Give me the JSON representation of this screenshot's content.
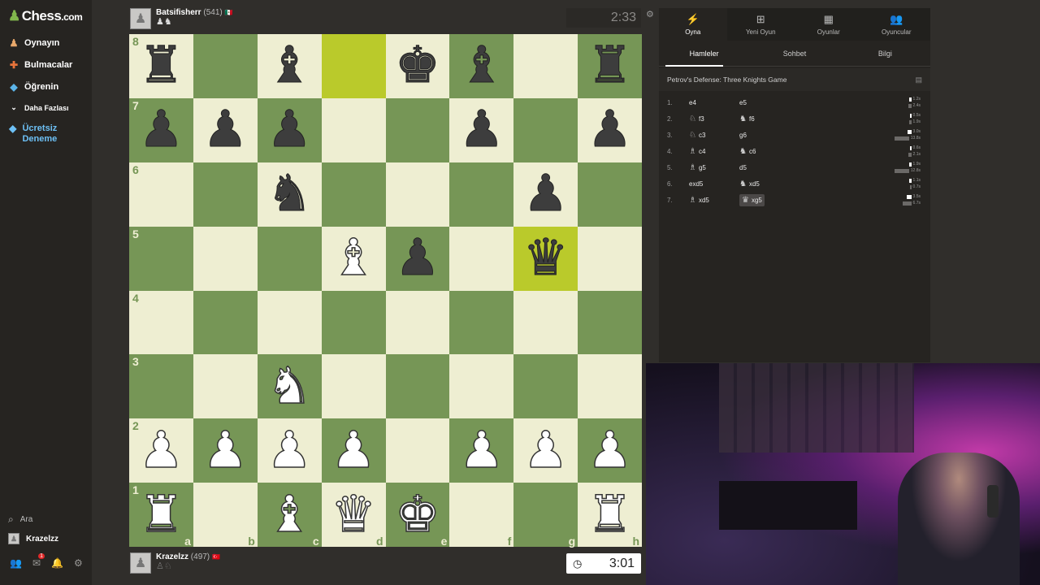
{
  "sidebar": {
    "logo_text": "Chess",
    "logo_domain": ".com",
    "logo_icon": "pawn-icon",
    "items": [
      {
        "label": "Oynayın",
        "icon": "play-icon"
      },
      {
        "label": "Bulmacalar",
        "icon": "puzzle-icon"
      },
      {
        "label": "Öğrenin",
        "icon": "learn-icon"
      },
      {
        "label": "Daha Fazlası",
        "icon": "chevron-down-icon"
      },
      {
        "label": "Ücretsiz Deneme",
        "icon": "diamond-icon"
      }
    ],
    "search_label": "Ara",
    "user_label": "Krazelzz",
    "notification_count": "1"
  },
  "top_player": {
    "name": "Batsifisherr",
    "rating": "(541)",
    "flag": "🇲🇽",
    "captured": "♟♞",
    "clock": "2:33"
  },
  "bottom_player": {
    "name": "Krazelzz",
    "rating": "(497)",
    "flag": "🇹🇷",
    "captured": "♙♘",
    "clock": "3:01"
  },
  "board": {
    "ranks": [
      "8",
      "7",
      "6",
      "5",
      "4",
      "3",
      "2",
      "1"
    ],
    "files": [
      "a",
      "b",
      "c",
      "d",
      "e",
      "f",
      "g",
      "h"
    ],
    "position": [
      [
        "r",
        "",
        "b",
        "",
        "k",
        "b",
        "",
        "r"
      ],
      [
        "p",
        "p",
        "p",
        "",
        "",
        "p",
        "",
        "p"
      ],
      [
        "",
        "",
        "n",
        "",
        "",
        "",
        "p",
        ""
      ],
      [
        "",
        "",
        "",
        "B",
        "p",
        "",
        "q",
        ""
      ],
      [
        "",
        "",
        "",
        "",
        "",
        "",
        "",
        ""
      ],
      [
        "",
        "",
        "N",
        "",
        "",
        "",
        "",
        ""
      ],
      [
        "P",
        "P",
        "P",
        "P",
        "",
        "P",
        "P",
        "P"
      ],
      [
        "R",
        "",
        "B",
        "Q",
        "K",
        "",
        "",
        "R"
      ]
    ],
    "highlight": [
      "d8",
      "g5"
    ]
  },
  "panel": {
    "tabs": [
      {
        "label": "Oyna",
        "icon": "lightning-icon"
      },
      {
        "label": "Yeni Oyun",
        "icon": "plus-icon"
      },
      {
        "label": "Oyunlar",
        "icon": "board-icon"
      },
      {
        "label": "Oyuncular",
        "icon": "players-icon"
      }
    ],
    "subtabs": [
      "Hamleler",
      "Sohbet",
      "Bilgi"
    ],
    "opening": "Petrov's Defense: Three Knights Game",
    "moves": [
      {
        "num": "1.",
        "white": "e4",
        "white_fig": "",
        "black": "e5",
        "black_fig": "",
        "wt": "1.2s",
        "bt": "2.4s",
        "wf": 0.08,
        "bf": 0.12
      },
      {
        "num": "2.",
        "white": "f3",
        "white_fig": "♘",
        "black": "f6",
        "black_fig": "♞",
        "wt": "0.5s",
        "bt": "1.9s",
        "wf": 0.05,
        "bf": 0.1
      },
      {
        "num": "3.",
        "white": "c3",
        "white_fig": "♘",
        "black": "g6",
        "black_fig": "",
        "wt": "3.0s",
        "bt": "13.8s",
        "wf": 0.15,
        "bf": 0.7
      },
      {
        "num": "4.",
        "white": "c4",
        "white_fig": "♗",
        "black": "c6",
        "black_fig": "♞",
        "wt": "0.6s",
        "bt": "2.1s",
        "wf": 0.05,
        "bf": 0.12
      },
      {
        "num": "5.",
        "white": "g5",
        "white_fig": "♗",
        "black": "d5",
        "black_fig": "",
        "wt": "1.9s",
        "bt": "12.8s",
        "wf": 0.1,
        "bf": 0.65
      },
      {
        "num": "6.",
        "white": "exd5",
        "white_fig": "",
        "black": "xd5",
        "black_fig": "♞",
        "wt": "1.1s",
        "bt": "0.7s",
        "wf": 0.07,
        "bf": 0.05
      },
      {
        "num": "7.",
        "white": "xd5",
        "white_fig": "♗",
        "black": "xg5",
        "black_fig": "♛",
        "wt": "3.5s",
        "bt": "6.7s",
        "wf": 0.18,
        "bf": 0.35
      }
    ]
  }
}
